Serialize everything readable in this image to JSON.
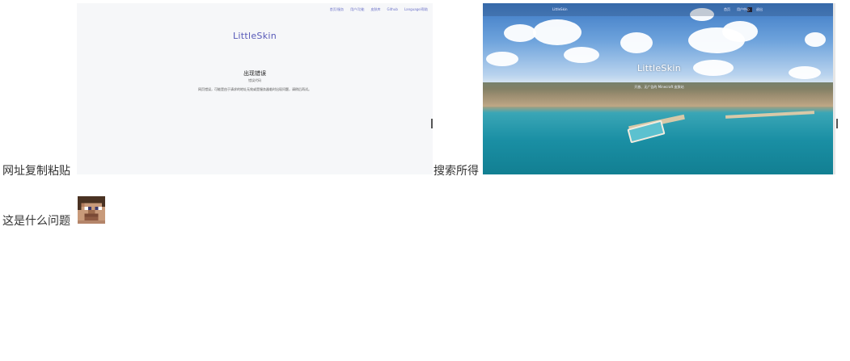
{
  "label_paste": "网址复制粘贴",
  "label_search": "搜索所得",
  "label_question": "这是什么问题",
  "shot1": {
    "nav": [
      "首页/服务",
      "用户/功能",
      "皮肤库",
      "Github",
      "Language/帮助"
    ],
    "brand": "LittleSkin",
    "error_title": "出现错误",
    "error_code": "错误代码",
    "error_message": "网页错误，可能是由于请求的地址无效或是服务器临时出现问题，请稍后再试。"
  },
  "shot2": {
    "nav_left": "LittleSkin",
    "nav_right": [
      "首页",
      "用户中心",
      "退出"
    ],
    "brand": "LittleSkin",
    "tagline": "开放、无广告的 Minecraft 皮肤站"
  },
  "icons": {
    "face": "steve-face-icon"
  }
}
